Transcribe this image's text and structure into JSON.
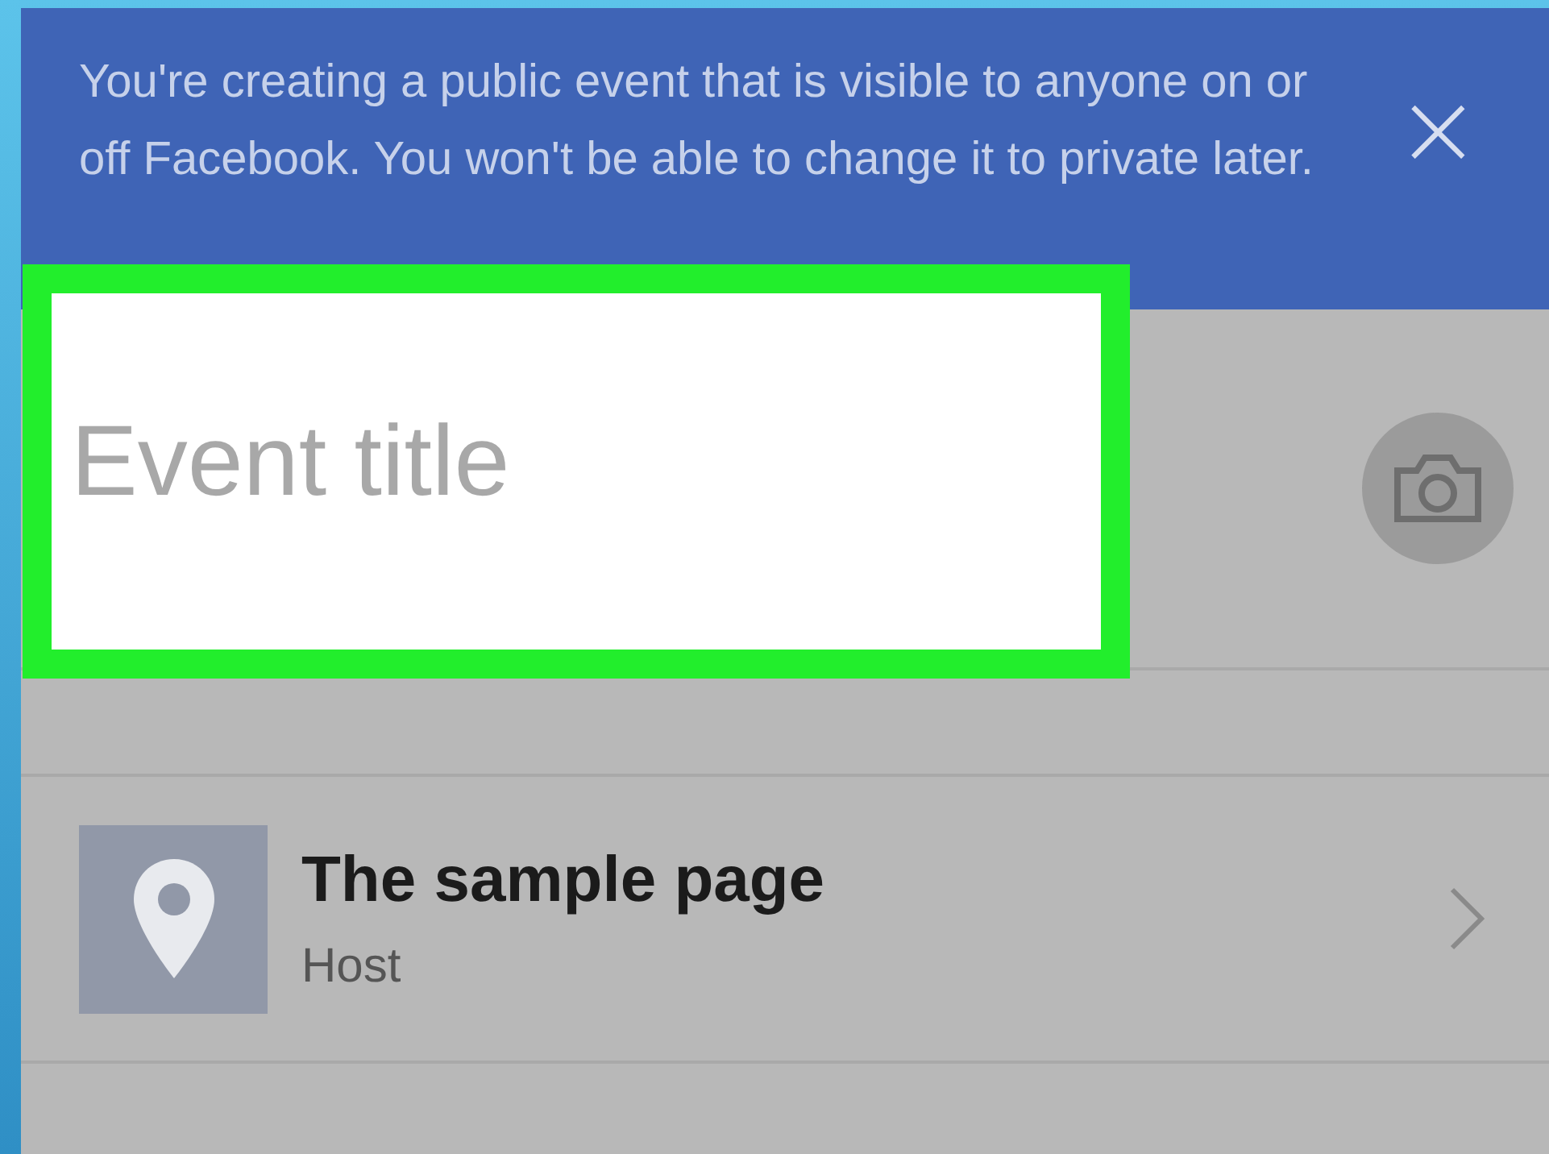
{
  "notice": {
    "text": "You're creating a public event that is visible to anyone on or off Facebook. You won't be able to change it to private later.",
    "close": "×"
  },
  "event_title": {
    "placeholder": "Event title",
    "highlighted": true
  },
  "host": {
    "name": "The sample page",
    "role": "Host"
  }
}
